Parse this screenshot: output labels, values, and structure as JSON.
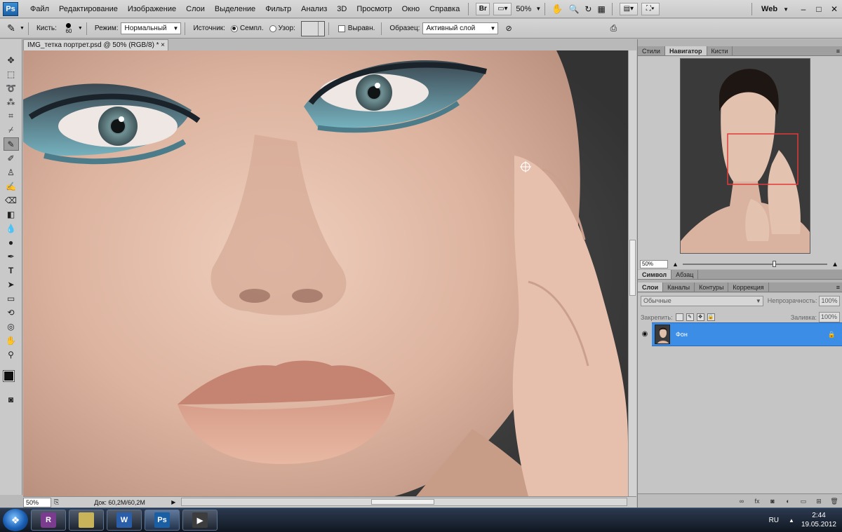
{
  "menubar": {
    "logo": "Ps",
    "items": [
      "Файл",
      "Редактирование",
      "Изображение",
      "Слои",
      "Выделение",
      "Фильтр",
      "Анализ",
      "3D",
      "Просмотр",
      "Окно",
      "Справка"
    ],
    "br_label": "Br",
    "zoom": "50%",
    "workspace": "Web",
    "window_controls": [
      "–",
      "□",
      "✕"
    ]
  },
  "options": {
    "brush_label": "Кисть:",
    "brush_size": "60",
    "mode_label": "Режим:",
    "mode_value": "Нормальный",
    "source_label": "Источник:",
    "source_option_sampled": "Семпл.",
    "source_option_pattern": "Узор:",
    "aligned_label": "Выравн.",
    "sample_label": "Образец:",
    "sample_value": "Активный слой"
  },
  "tools": {
    "active": "healing-brush",
    "items": [
      "move",
      "marquee",
      "lasso",
      "quick-select",
      "crop",
      "eyedropper",
      "healing-brush",
      "brush",
      "clone-stamp",
      "history-brush",
      "eraser",
      "gradient",
      "blur",
      "dodge",
      "pen",
      "type",
      "path-select",
      "shape",
      "3d-rotate",
      "3d-orbit",
      "hand",
      "zoom"
    ]
  },
  "document": {
    "tab_title": "IMG_тетка портрет.psd @ 50% (RGB/8) *",
    "close": "×",
    "status_zoom": "50%",
    "status_doc": "Док: 60,2M/60,2M"
  },
  "panels": {
    "top_tabs": [
      "Стили",
      "Навигатор",
      "Кисти"
    ],
    "top_active": "Навигатор",
    "navigator_zoom": "50%",
    "mid_tabs": [
      "Символ",
      "Абзац"
    ],
    "layers_tabs": [
      "Слои",
      "Каналы",
      "Контуры",
      "Коррекция"
    ],
    "layers_active": "Слои",
    "blend_mode": "Обычные",
    "opacity_label": "Непрозрачность:",
    "opacity_value": "100%",
    "lock_label": "Закрепить:",
    "fill_label": "Заливка:",
    "fill_value": "100%",
    "layer_name": "Фон"
  },
  "taskbar": {
    "apps": [
      "start",
      "winrar",
      "folder",
      "word",
      "photoshop",
      "media"
    ],
    "active_app": "photoshop",
    "lang": "RU",
    "time": "2:44",
    "date": "19.05.2012"
  },
  "colors": {
    "accent": "#3b8de6",
    "foreground_color": "#111111",
    "background_color": "#111111",
    "nav_frame": "#e03a3a"
  }
}
